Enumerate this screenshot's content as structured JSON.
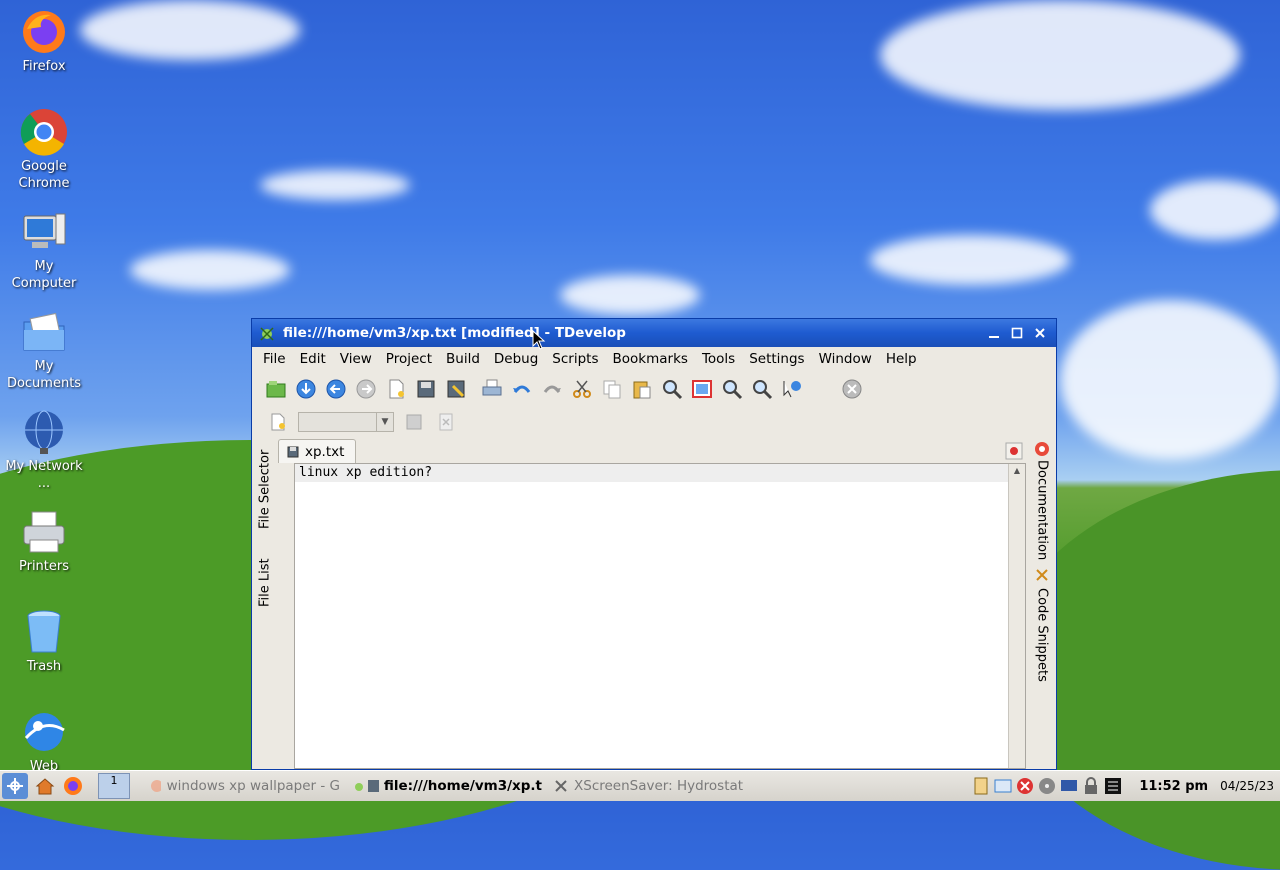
{
  "desktop": {
    "icons": [
      {
        "label": "Firefox"
      },
      {
        "label": "Google Chrome"
      },
      {
        "label": "My Computer"
      },
      {
        "label": "My Documents"
      },
      {
        "label": "My Network ..."
      },
      {
        "label": "Printers"
      },
      {
        "label": "Trash"
      },
      {
        "label": "Web"
      }
    ]
  },
  "window": {
    "title": "file:///home/vm3/xp.txt [modified] - TDevelop",
    "menu": [
      "File",
      "Edit",
      "View",
      "Project",
      "Build",
      "Debug",
      "Scripts",
      "Bookmarks",
      "Tools",
      "Settings",
      "Window",
      "Help"
    ],
    "left_tabs": [
      "File Selector",
      "File List"
    ],
    "right_tabs": [
      "Documentation",
      "Code Snippets"
    ],
    "doc_tab": "xp.txt",
    "editor_lines": [
      "linux xp edition?"
    ]
  },
  "taskbar": {
    "tasks": [
      {
        "label": "windows xp wallpaper - G"
      },
      {
        "label": "file:///home/vm3/xp.t"
      },
      {
        "label": "XScreenSaver: Hydrostat"
      }
    ],
    "desktop_number": "1",
    "time": "11:52 pm",
    "date": "04/25/23"
  },
  "colors": {
    "titlebar": "#1e5bd0",
    "sky": "#3f7be8",
    "grass": "#4f9a2a"
  }
}
